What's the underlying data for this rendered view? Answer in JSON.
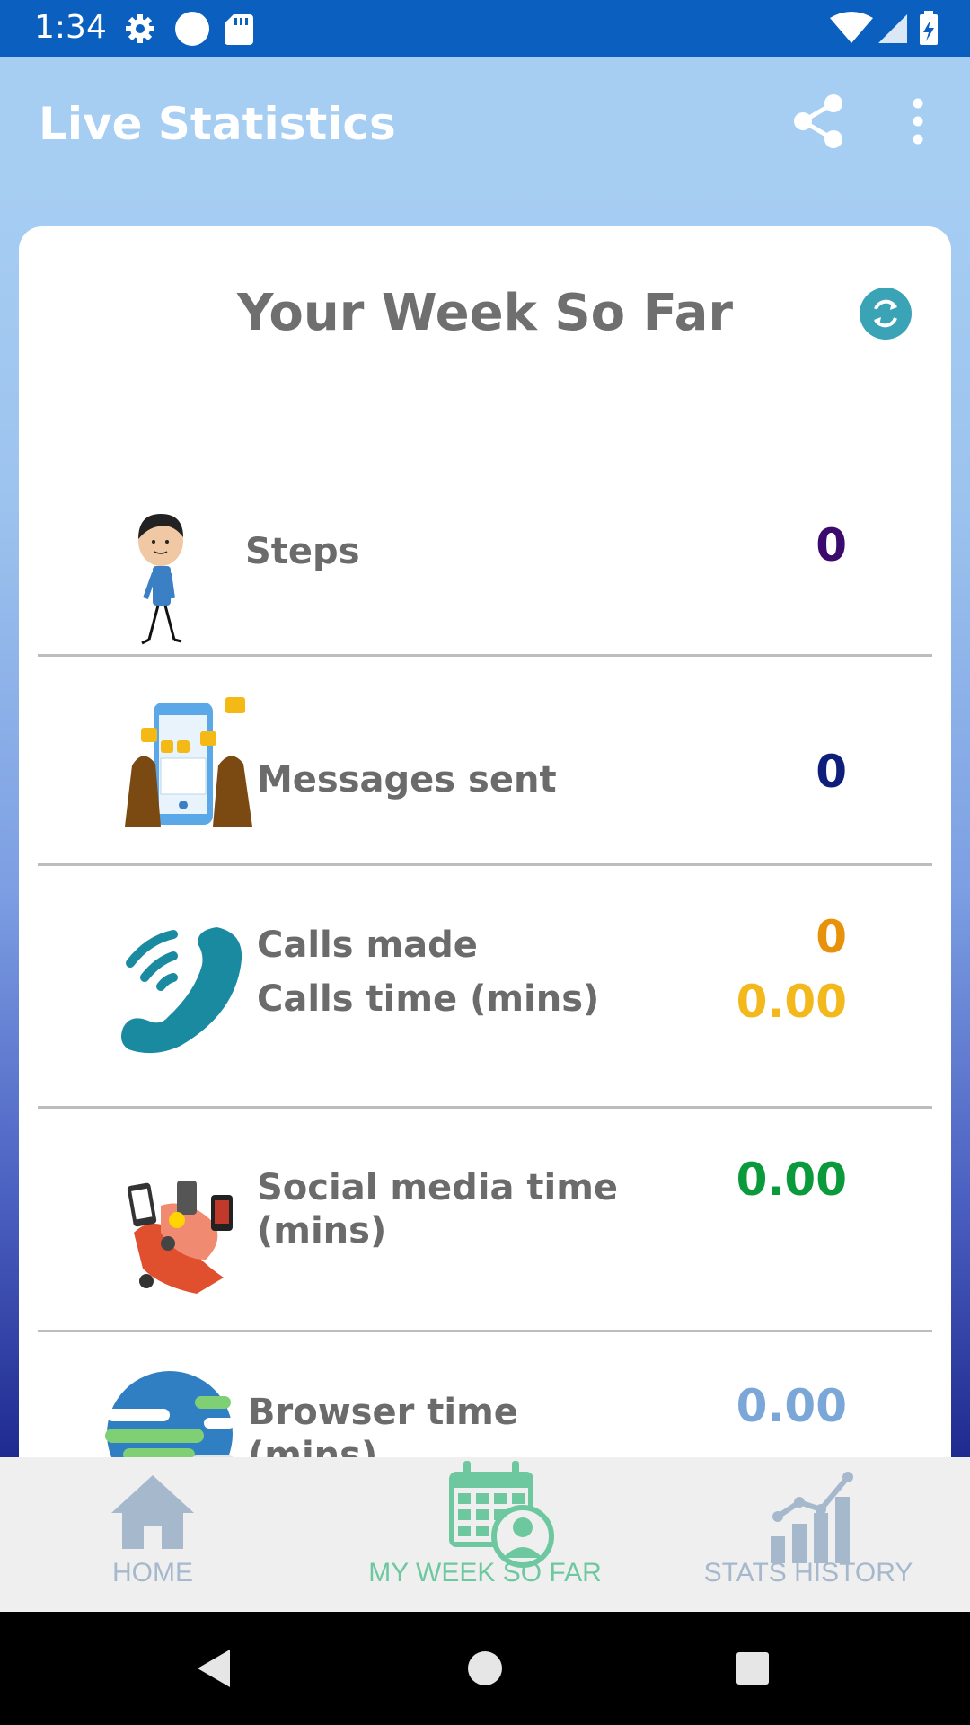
{
  "status_bar": {
    "time": "1:34",
    "icons_left": [
      "gear-icon",
      "circle-icon",
      "sd-card-icon"
    ],
    "icons_right": [
      "wifi-icon",
      "signal-icon",
      "battery-icon"
    ]
  },
  "app_bar": {
    "title": "Live Statistics",
    "actions": [
      "share-icon",
      "more-vert-icon"
    ]
  },
  "card": {
    "title": "Your Week So Far",
    "refresh_icon": "refresh-icon",
    "rows": [
      {
        "icon": "walking-person-icon",
        "labels": [
          "Steps"
        ],
        "values": [
          {
            "text": "0",
            "color": "#3b0a6e"
          }
        ]
      },
      {
        "icon": "phone-messages-icon",
        "labels": [
          "Messages sent"
        ],
        "values": [
          {
            "text": "0",
            "color": "#0d1f7a"
          }
        ]
      },
      {
        "icon": "phone-call-icon",
        "labels": [
          "Calls made",
          "Calls time (mins)"
        ],
        "values": [
          {
            "text": "0",
            "color": "#e8920c"
          },
          {
            "text": "0.00",
            "color": "#f2b81c"
          }
        ]
      },
      {
        "icon": "social-media-hands-icon",
        "labels": [
          "Social media time",
          "(mins)"
        ],
        "values": [
          {
            "text": "0.00",
            "color": "#0a9a3c"
          }
        ]
      },
      {
        "icon": "globe-icon",
        "labels": [
          "Browser time",
          "(mins)"
        ],
        "values": [
          {
            "text": "0.00",
            "color": "#7ba7d8"
          }
        ]
      }
    ]
  },
  "bottom_nav": {
    "items": [
      {
        "label": "HOME",
        "icon": "home-icon",
        "color": "#a6b9cc",
        "selected": false
      },
      {
        "label": "MY WEEK SO FAR",
        "icon": "calendar-person-icon",
        "color": "#6dc8a0",
        "selected": true
      },
      {
        "label": "STATS HISTORY",
        "icon": "bar-chart-icon",
        "color": "#a6b9cc",
        "selected": false
      }
    ]
  },
  "system_nav": [
    "back-icon",
    "home-circle-icon",
    "recents-icon"
  ]
}
